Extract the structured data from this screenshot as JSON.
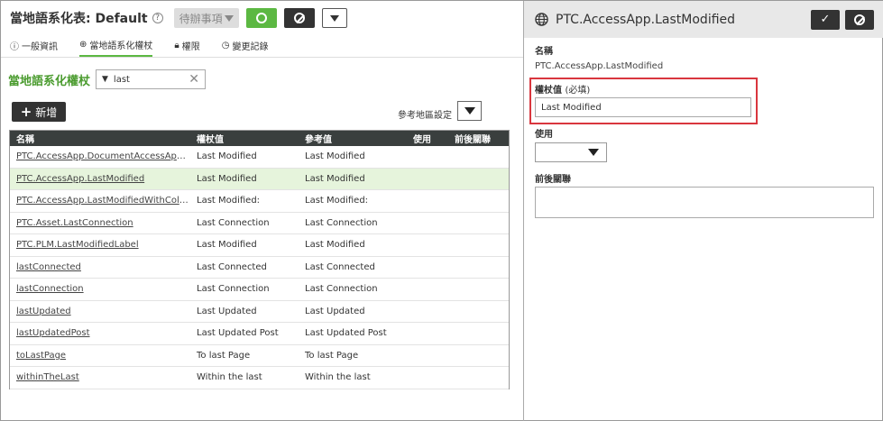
{
  "header": {
    "title": "當地語系化表: Default",
    "status_value": "待辦事項"
  },
  "tabs": [
    {
      "label": "一般資訊",
      "icon": "info-circle-icon"
    },
    {
      "label": "當地語系化權杖",
      "icon": "globe-icon"
    },
    {
      "label": "權限",
      "icon": "lock-icon"
    },
    {
      "label": "變更記錄",
      "icon": "clock-icon"
    }
  ],
  "section": {
    "title": "當地語系化權杖",
    "filter_value": "last",
    "add_label": "新增",
    "region_label": "參考地區設定"
  },
  "table": {
    "headers": [
      "名稱",
      "權杖值",
      "參考值",
      "使用",
      "前後關聯"
    ],
    "rows": [
      {
        "name": "PTC.AccessApp.DocumentAccessApp.A...",
        "value": "Last Modified",
        "ref": "Last Modified"
      },
      {
        "name": "PTC.AccessApp.LastModified",
        "value": "Last Modified",
        "ref": "Last Modified"
      },
      {
        "name": "PTC.AccessApp.LastModifiedWithColon",
        "value": "Last Modified:",
        "ref": "Last Modified:"
      },
      {
        "name": "PTC.Asset.LastConnection",
        "value": "Last Connection",
        "ref": "Last Connection"
      },
      {
        "name": "PTC.PLM.LastModifiedLabel",
        "value": "Last Modified",
        "ref": "Last Modified"
      },
      {
        "name": "lastConnected",
        "value": "Last Connected",
        "ref": "Last Connected"
      },
      {
        "name": "lastConnection",
        "value": "Last Connection",
        "ref": "Last Connection"
      },
      {
        "name": "lastUpdated",
        "value": "Last Updated",
        "ref": "Last Updated"
      },
      {
        "name": "lastUpdatedPost",
        "value": "Last Updated Post",
        "ref": "Last Updated Post"
      },
      {
        "name": "toLastPage",
        "value": "To last Page",
        "ref": "To last Page"
      },
      {
        "name": "withinTheLast",
        "value": "Within the last",
        "ref": "Within the last"
      }
    ],
    "selected_index": 1
  },
  "detail": {
    "title": "PTC.AccessApp.LastModified",
    "name_label": "名稱",
    "name_value": "PTC.AccessApp.LastModified",
    "token_label": "權杖值",
    "required_text": "(必填)",
    "token_value": "Last Modified",
    "use_label": "使用",
    "context_label": "前後關聯"
  },
  "colors": {
    "accent_green": "#5cb842",
    "dark": "#333333",
    "highlight_red": "#d9363e"
  }
}
